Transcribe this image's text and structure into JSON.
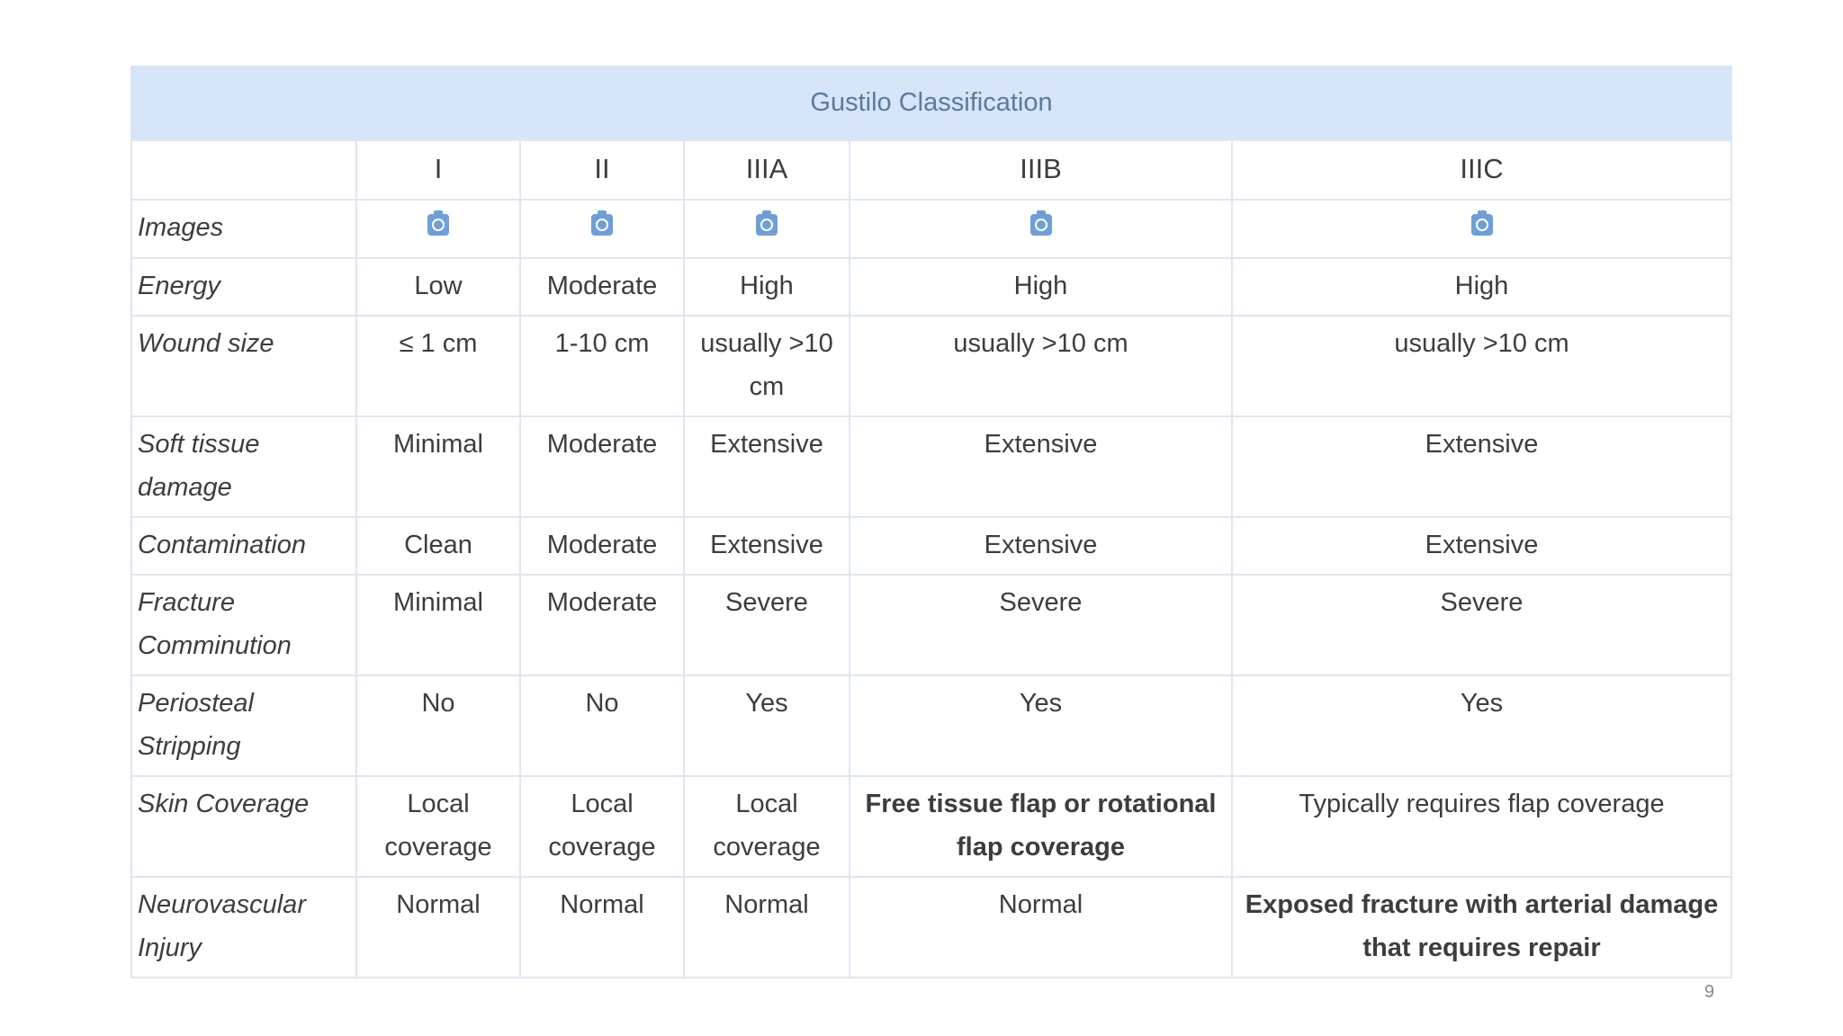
{
  "table": {
    "caption": "Gustilo Classification",
    "columns": [
      "",
      "I",
      "II",
      "IIIA",
      "IIIB",
      "IIIC"
    ],
    "images_label": "Images",
    "image_icon": "camera-icon",
    "image_icon_color": "#6f9fd6",
    "rows": [
      {
        "label": "Energy",
        "values": [
          "Low",
          "Moderate",
          "High",
          "High",
          "High"
        ]
      },
      {
        "label": "Wound size",
        "values": [
          "≤ 1 cm",
          "1-10 cm",
          "usually >10 cm",
          "usually >10 cm",
          "usually >10 cm"
        ]
      },
      {
        "label": "Soft tissue damage",
        "values": [
          "Minimal",
          "Moderate",
          "Extensive",
          "Extensive",
          "Extensive"
        ]
      },
      {
        "label": "Contamination",
        "values": [
          "Clean",
          "Moderate",
          "Extensive",
          "Extensive",
          "Extensive"
        ]
      },
      {
        "label": "Fracture Comminution",
        "values": [
          "Minimal",
          "Moderate",
          "Severe",
          "Severe",
          "Severe"
        ]
      },
      {
        "label": "Periosteal Stripping",
        "values": [
          "No",
          "No",
          "Yes",
          "Yes",
          "Yes"
        ]
      },
      {
        "label": "Skin Coverage",
        "values": [
          "Local coverage",
          "Local coverage",
          "Local coverage",
          "Free tissue flap or rotational flap coverage",
          "Typically requires flap coverage"
        ]
      },
      {
        "label": "Neurovascular Injury",
        "values": [
          "Normal",
          "Normal",
          "Normal",
          "Normal",
          "Exposed fracture with arterial damage that requires repair"
        ]
      }
    ]
  },
  "colors": {
    "caption_bg": "#d7e5f8",
    "caption_text": "#5a7a9c",
    "grid": "#dfe6f1"
  },
  "slide_number": "9"
}
